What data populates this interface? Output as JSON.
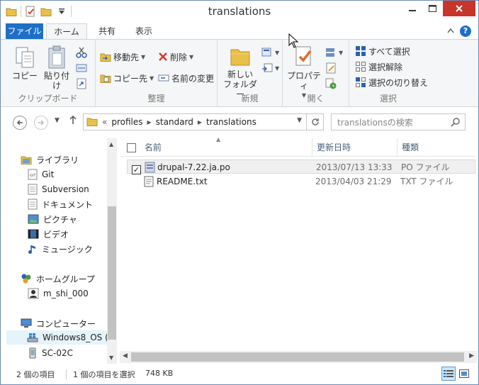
{
  "window": {
    "title": "translations"
  },
  "ribbon_tabs": {
    "file": "ファイル",
    "home": "ホーム",
    "share": "共有",
    "view": "表示"
  },
  "ribbon": {
    "clipboard": {
      "copy": "コピー",
      "paste": "貼り付け",
      "label": "クリップボード"
    },
    "organize": {
      "move_to": "移動先",
      "copy_to": "コピー先",
      "delete": "削除",
      "rename": "名前の変更",
      "label": "整理"
    },
    "new": {
      "new_folder_line1": "新しい",
      "new_folder_line2": "フォルダー",
      "label": "新規"
    },
    "open": {
      "properties": "プロパティ",
      "label": "開く"
    },
    "select": {
      "select_all": "すべて選択",
      "select_none": "選択解除",
      "invert_selection": "選択の切り替え",
      "label": "選択"
    }
  },
  "address": {
    "overflow": "«",
    "breadcrumbs": [
      "profiles",
      "standard",
      "translations"
    ]
  },
  "search": {
    "placeholder": "translationsの検索"
  },
  "nav_pane": {
    "library": "ライブラリ",
    "library_items": [
      "Git",
      "Subversion",
      "ドキュメント",
      "ピクチャ",
      "ビデオ",
      "ミュージック"
    ],
    "homegroup": "ホームグループ",
    "homegroup_user": "m_shi_000",
    "computer": "コンピューター",
    "computer_items": [
      "Windows8_OS (",
      "SC-02C"
    ]
  },
  "columns": {
    "name": "名前",
    "date": "更新日時",
    "type": "種類"
  },
  "files": [
    {
      "name": "drupal-7.22.ja.po",
      "date": "2013/07/13 13:33",
      "type": "PO ファイル",
      "selected": true
    },
    {
      "name": "README.txt",
      "date": "2013/04/03 21:29",
      "type": "TXT ファイル",
      "selected": false
    }
  ],
  "status": {
    "item_count": "2 個の項目",
    "selection": "1 個の項目を選択",
    "size": "748 KB"
  },
  "colors": {
    "accent": "#1e6fc8",
    "close": "#c7352b",
    "selection": "#e5f3fb"
  }
}
